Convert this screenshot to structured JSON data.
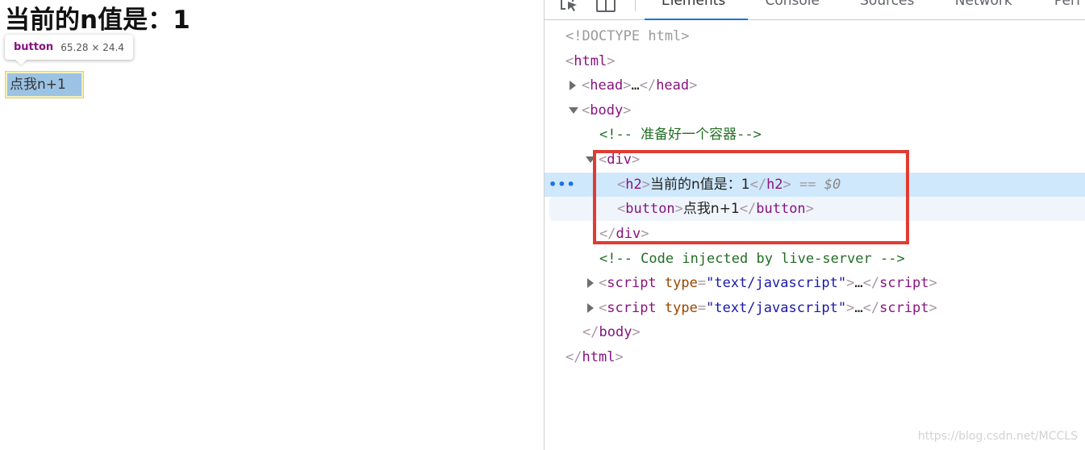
{
  "preview": {
    "heading": "当前的n值是：1",
    "tooltip": {
      "tag": "button",
      "dimensions": "65.28 × 24.4"
    },
    "button_label": "点我n+1",
    "colors": {
      "button_highlight": "#9cc3e4",
      "margin_highlight": "#f6efb7"
    }
  },
  "devtools": {
    "toolbar": {
      "icons": [
        "inspect-element-icon",
        "device-toolbar-icon"
      ],
      "tabs": [
        {
          "label": "Elements",
          "active": true
        },
        {
          "label": "Console",
          "active": false
        },
        {
          "label": "Sources",
          "active": false
        },
        {
          "label": "Network",
          "active": false
        },
        {
          "label": "Perf",
          "active": false
        }
      ]
    },
    "dom": {
      "doctype": "<!DOCTYPE html>",
      "html_open": "html",
      "head_tag": "head",
      "ellipsis": "…",
      "body_tag": "body",
      "comment_container": "<!-- 准备好一个容器-->",
      "div_tag": "div",
      "h2_tag": "h2",
      "h2_text": "当前的n值是：1",
      "eq": "==",
      "dollar0": "$0",
      "button_tag": "button",
      "button_text": "点我n+1",
      "comment_injected": "<!-- Code injected by live-server -->",
      "script_tag": "script",
      "script_attr_name": "type",
      "script_attr_value": "\"text/javascript\"",
      "selected_line_marker": "•••"
    },
    "colors": {
      "tag": "#881280",
      "comment": "#236e25",
      "attr_name": "#994500",
      "attr_value": "#1a1aa6",
      "selected_row": "#cfe8fc",
      "annotation_box": "#e03c31",
      "active_tab_underline": "#1a73e8"
    }
  },
  "watermark": "https://blog.csdn.net/MCCLS"
}
